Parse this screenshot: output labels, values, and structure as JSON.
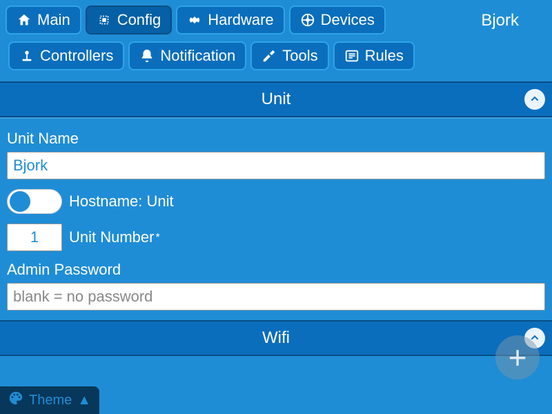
{
  "nav": {
    "device_name": "Bjork",
    "tabs": {
      "main": "Main",
      "config": "Config",
      "hardware": "Hardware",
      "devices": "Devices",
      "controllers": "Controllers",
      "notification": "Notification",
      "tools": "Tools",
      "rules": "Rules"
    }
  },
  "unit": {
    "title": "Unit",
    "name_label": "Unit Name",
    "name_value": "Bjork",
    "hostname_label": "Hostname: Unit",
    "hostname_toggle": false,
    "number_label": "Unit Number",
    "number_value": "1",
    "number_required_mark": "*",
    "admin_pw_label": "Admin Password",
    "admin_pw_value": "",
    "admin_pw_placeholder": "blank = no password"
  },
  "wifi": {
    "title": "Wifi"
  },
  "theme_button": "Theme",
  "icons": {
    "main": "home",
    "config": "chip",
    "hardware": "gear",
    "devices": "network",
    "controllers": "joystick",
    "notification": "bell",
    "tools": "wrench",
    "rules": "list",
    "collapse": "chevron-up",
    "add": "plus",
    "theme": "palette",
    "theme_arrow": "triangle-up"
  }
}
